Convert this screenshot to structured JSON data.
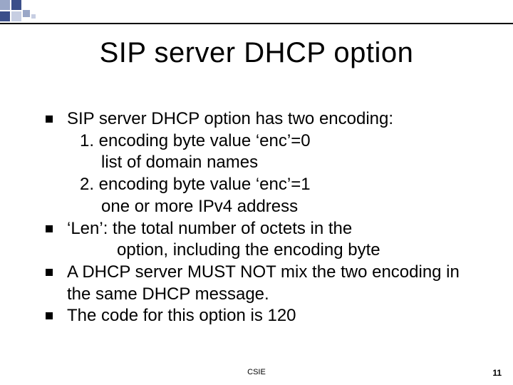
{
  "slide": {
    "title": "SIP server DHCP option",
    "bullets": [
      {
        "lead": "SIP server DHCP option has two encoding:",
        "sub": [
          "1. encoding byte value ‘enc’=0",
          "list of domain names",
          "2. encoding byte value ‘enc’=1",
          "one or more IPv4 address"
        ]
      },
      {
        "lead": " ‘Len’: the total number of octets in the",
        "sub_len": "option, including the encoding byte"
      },
      {
        "lead": "A DHCP server MUST NOT mix the two encoding in the same DHCP message."
      },
      {
        "lead": "The code for this option is 120"
      }
    ],
    "footer": "CSIE",
    "page_number": "11"
  }
}
